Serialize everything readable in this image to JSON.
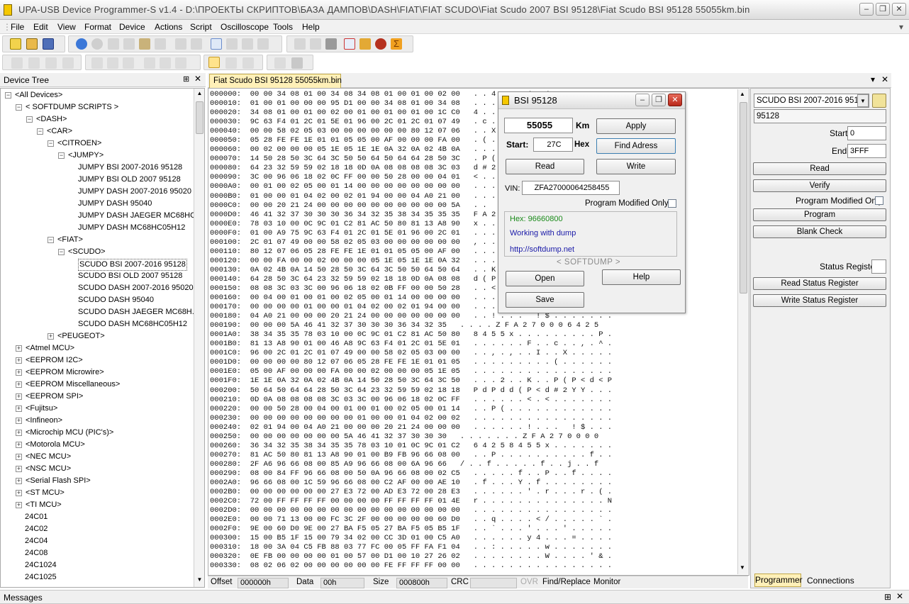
{
  "window": {
    "title": "UPA-USB Device Programmer-S v1.4 - D:\\ПРОЕКТЫ СКРИПТОВ\\БАЗА ДАМПОВ\\DASH\\FIAT\\FIAT SCUDO\\Fiat Scudo 2007 BSI 95128\\Fiat Scudo BSI 95128   55055km.bin"
  },
  "menu": [
    "File",
    "Edit",
    "View",
    "Format",
    "Device",
    "Actions",
    "Script",
    "Oscilloscope",
    "Tools",
    "Help"
  ],
  "device_tree": {
    "title": "Device Tree",
    "nodes": [
      {
        "label": "<All Devices>",
        "level": 0,
        "exp": "-"
      },
      {
        "label": "< SOFTDUMP SCRIPTS >",
        "level": 1,
        "exp": "-"
      },
      {
        "label": "<DASH>",
        "level": 2,
        "exp": "-"
      },
      {
        "label": "<CAR>",
        "level": 3,
        "exp": "-"
      },
      {
        "label": "<CITROEN>",
        "level": 4,
        "exp": "-"
      },
      {
        "label": "<JUMPY>",
        "level": 5,
        "exp": "-"
      },
      {
        "label": "JUMPY BSI 2007-2016 95128",
        "level": 6,
        "exp": ""
      },
      {
        "label": "JUMPY BSI OLD 2007 95128",
        "level": 6,
        "exp": ""
      },
      {
        "label": "JUMPY DASH 2007-2016 95020",
        "level": 6,
        "exp": ""
      },
      {
        "label": "JUMPY DASH 95040",
        "level": 6,
        "exp": ""
      },
      {
        "label": "JUMPY DASH JAEGER MC68HC...",
        "level": 6,
        "exp": ""
      },
      {
        "label": "JUMPY DASH MC68HC05H12",
        "level": 6,
        "exp": ""
      },
      {
        "label": "<FIAT>",
        "level": 4,
        "exp": "-"
      },
      {
        "label": "<SCUDO>",
        "level": 5,
        "exp": "-"
      },
      {
        "label": "SCUDO BSI 2007-2016 95128",
        "level": 6,
        "exp": "",
        "selected": true
      },
      {
        "label": "SCUDO BSI OLD 2007 95128",
        "level": 6,
        "exp": ""
      },
      {
        "label": "SCUDO DASH 2007-2016 95020",
        "level": 6,
        "exp": ""
      },
      {
        "label": "SCUDO DASH 95040",
        "level": 6,
        "exp": ""
      },
      {
        "label": "SCUDO DASH JAEGER MC68H...",
        "level": 6,
        "exp": ""
      },
      {
        "label": "SCUDO DASH MC68HC05H12",
        "level": 6,
        "exp": ""
      },
      {
        "label": "<PEUGEOT>",
        "level": 4,
        "exp": "+"
      },
      {
        "label": "<Atmel MCU>",
        "level": 1,
        "exp": "+"
      },
      {
        "label": "<EEPROM I2C>",
        "level": 1,
        "exp": "+"
      },
      {
        "label": "<EEPROM Microwire>",
        "level": 1,
        "exp": "+"
      },
      {
        "label": "<EEPROM Miscellaneous>",
        "level": 1,
        "exp": "+"
      },
      {
        "label": "<EEPROM SPI>",
        "level": 1,
        "exp": "+"
      },
      {
        "label": "<Fujitsu>",
        "level": 1,
        "exp": "+"
      },
      {
        "label": "<Infineon>",
        "level": 1,
        "exp": "+"
      },
      {
        "label": "<Microchip MCU (PIC's)>",
        "level": 1,
        "exp": "+"
      },
      {
        "label": "<Motorola MCU>",
        "level": 1,
        "exp": "+"
      },
      {
        "label": "<NEC MCU>",
        "level": 1,
        "exp": "+"
      },
      {
        "label": "<NSC MCU>",
        "level": 1,
        "exp": "+"
      },
      {
        "label": "<Serial Flash SPI>",
        "level": 1,
        "exp": "+"
      },
      {
        "label": "<ST MCU>",
        "level": 1,
        "exp": "+"
      },
      {
        "label": "<TI MCU>",
        "level": 1,
        "exp": "+"
      },
      {
        "label": "24C01",
        "level": 1,
        "exp": ""
      },
      {
        "label": "24C02",
        "level": 1,
        "exp": ""
      },
      {
        "label": "24C04",
        "level": 1,
        "exp": ""
      },
      {
        "label": "24C08",
        "level": 1,
        "exp": ""
      },
      {
        "label": "24C1024",
        "level": 1,
        "exp": ""
      },
      {
        "label": "24C1025",
        "level": 1,
        "exp": ""
      }
    ]
  },
  "editor_tab": "Fiat Scudo BSI 95128   55055km.bin",
  "hex_lines": [
    "000000:  00 00 34 08 01 00 34 08 34 08 01 00 01 00 02 00   . . 4 . . . 4 . 4 . . . . . . .",
    "000010:  01 00 01 00 00 00 95 D1 00 00 34 08 01 00 34 08   . . . . . . . . . . 4 . . . 4 .",
    "000020:  34 08 01 00 01 00 02 00 01 00 01 00 01 00 1C C0   4 . . . . . . . . . . . . . . .",
    "000030:  9C 63 F4 01 2C 01 5E 01 96 00 2C 01 2C 01 07 49   . c . . , . ^ . . . , . , . . I",
    "000040:  00 00 58 02 05 03 00 00 00 00 00 00 80 12 07 06   . . X . . . . . . . . . . . . .",
    "000050:  05 28 FE FE 1E 01 01 05 05 00 AF 00 00 00 FA 00   . ( . . . . . . . . . . . . . .",
    "000060:  00 02 00 00 00 05 1E 05 1E 1E 0A 32 0A 02 4B 0A   . . . . . . . . . . . 2 . . K .",
    "000070:  14 50 28 50 3C 64 3C 50 50 64 50 64 64 28 50 3C   . P ( P < d < P P d P d d ( P <",
    "000080:  64 23 32 59 59 02 18 18 0D 0A 08 08 08 08 3C 03   d # 2 Y Y . . . . . . . . . < .",
    "000090:  3C 00 96 06 18 02 0C FF 00 00 50 28 00 00 04 01   < . . . . . . . . . P ( . . . .",
    "0000A0:  00 01 00 02 05 00 01 14 00 00 00 00 00 00 00 00   . . . . . . . . . . . . . . . .",
    "0000B0:  01 00 00 01 04 02 00 02 01 94 00 00 04 A0 21 00   . . . . . . . . . . . . . . ! .",
    "0000C0:  00 00 20 21 24 00 00 00 00 00 00 00 00 00 00 5A   . .   ! $ . . . . . . . . . . Z",
    "0000D0:  46 41 32 37 30 30 30 36 34 32 35 38 34 35 35 35   F A 2 7 0 0 0 6 4 2 5 8 4 5 5 5",
    "0000E0:  78 03 10 00 0C 9C 01 C2 81 AC 50 80 81 13 A8 90   x . . . . . . . . . P . . . . .",
    "0000F0:  01 00 A9 75 9C 63 F4 01 2C 01 5E 01 96 00 2C 01   . . . u . c . . , . ^ . . . , .",
    "000100:  2C 01 07 49 00 00 58 02 05 03 00 00 00 00 00 00   , . . I . . X . . . . . . . . .",
    "000110:  80 12 07 06 05 28 FE FE 1E 01 01 05 05 00 AF 00   . . . . . ( . . . . . . . . . .",
    "000120:  00 00 FA 00 00 02 00 00 00 05 1E 05 1E 1E 0A 32   . . . . . . . . . . . . . . . 2",
    "000130:  0A 02 4B 0A 14 50 28 50 3C 64 3C 50 50 64 50 64   . . K . . P ( P < d < P P d P d",
    "000140:  64 28 50 3C 64 23 32 59 59 02 18 18 0D 0A 08 08   d ( P < d # 2 Y Y . . . . . . .",
    "000150:  08 08 3C 03 3C 00 96 06 18 02 0B FF 00 00 50 28   . . < . < . . . . . . . . . P (",
    "000160:  00 04 00 01 00 01 00 02 05 00 01 14 00 00 00 00   . . . . . . . . . . . . . . . .",
    "000170:  00 00 00 00 01 00 00 01 04 02 00 02 01 94 00 00   . . . . . . . . . . . . . . . .",
    "000180:  04 A0 21 00 00 00 20 21 24 00 00 00 00 00 00 00   . . ! . . .   ! $ . . . . . . .",
    "000190:  00 00 00 5A 46 41 32 37 30 30 30 36 34 32 35   . . . . Z F A 2 7 0 0 0 6 4 2 5",
    "0001A0:  38 34 35 35 78 03 10 00 0C 9C 01 C2 81 AC 50 80   8 4 5 5 x . . . . . . . . . P .",
    "0001B0:  81 13 A8 90 01 00 46 A8 9C 63 F4 01 2C 01 5E 01   . . . . . . F . . c . . , . ^ .",
    "0001C0:  96 00 2C 01 2C 01 07 49 00 00 58 02 05 03 00 00   . . , . , . . I . . X . . . . .",
    "0001D0:  00 00 00 00 80 12 07 06 05 28 FE FE 1E 01 01 05   . . . . . . . . . ( . . . . . .",
    "0001E0:  05 00 AF 00 00 00 FA 00 00 02 00 00 00 05 1E 05   . . . . . . . . . . . . . . . .",
    "0001F0:  1E 1E 0A 32 0A 02 4B 0A 14 50 28 50 3C 64 3C 50   . . . 2 . . K . . P ( P < d < P",
    "000200:  50 64 50 64 64 28 50 3C 64 23 32 59 59 02 18 18   P d P d d ( P < d # 2 Y Y . . .",
    "000210:  0D 0A 08 08 08 08 3C 03 3C 00 96 06 18 02 0C FF   . . . . . . < . < . . . . . . .",
    "000220:  00 00 50 28 00 04 00 01 00 01 00 02 05 00 01 14   . . P ( . . . . . . . . . . . .",
    "000230:  00 00 00 00 00 00 00 00 01 00 00 01 04 02 00 02   . . . . . . . . . . . . . . . .",
    "000240:  02 01 94 00 04 A0 21 00 00 00 20 21 24 00 00 00   . . . . . . ! . . .   ! $ . . .",
    "000250:  00 00 00 00 00 00 00 5A 46 41 32 37 30 30 30   . . . . . . . Z F A 2 7 0 0 0 0",
    "000260:  36 34 32 35 38 34 35 35 78 03 10 01 0C 9C 01 C2   6 4 2 5 8 4 5 5 x . . . . . . .",
    "000270:  81 AC 50 80 81 13 A8 90 01 00 B9 FB 96 66 08 00   . . P . . . . . . . . . . f . .",
    "000280:  2F A6 96 66 08 00 85 A9 96 66 08 00 6A 96 66   / . . f . . . . . f . . j . . f",
    "000290:  08 00 84 FF 96 66 08 00 50 0A 96 66 08 00 02 C5   . . . . . f . . P . . f . . . .",
    "0002A0:  96 66 08 00 1C 59 96 66 08 00 C2 AF 00 00 AE 10   . f . . . Y . f . . . . . . . .",
    "0002B0:  00 00 00 00 00 00 27 E3 72 00 AD E3 72 00 28 E3   . . . . . . ' . r . . . r . ( .",
    "0002C0:  72 00 FF FF FF FF 00 00 00 00 FF FF FF FF 01 4E   r . . . . . . . . . . . . . . N",
    "0002D0:  00 00 00 00 00 00 00 00 00 00 00 00 00 00 00 00   . . . . . . . . . . . . . . . .",
    "0002E0:  00 00 71 13 00 00 FC 3C 2F 00 00 00 00 00 60 D0   . . q . . . . < / . . . . . ` .",
    "0002F0:  9E 00 60 D0 9E 00 27 BA F5 05 27 BA F5 05 B5 1F   . . ` . . . ' . . . ' . . . . .",
    "000300:  15 00 B5 1F 15 00 79 34 02 00 CC 3D 01 00 C5 A0   . . . . . . y 4 . . . = . . . .",
    "000310:  18 00 3A 04 C5 FB 88 03 77 FC 00 05 FF FA F1 04   . . : . . . . . w . . . . . . .",
    "000320:  0E FB 00 00 00 00 01 00 57 00 D1 00 10 27 26 02   . . . . . . . . W . . . . ' & .",
    "000330:  08 02 06 02 00 00 00 00 00 00 FE FF FF FF 00 00   . . . . . . . . . . . . . . . ."
  ],
  "dialog": {
    "title": "BSI 95128",
    "km_value": "55055",
    "km_unit": "Km",
    "start_label": "Start:",
    "start_value": "27C",
    "hex_unit": "Hex",
    "vin_label": "VIN:",
    "vin_value": "ZFA27000064258455",
    "program_modified_only": "Program Modified Only",
    "info_hex": "Hex: 96660800",
    "info_working": "Working with dump",
    "info_url": "http://softdump.net",
    "brand": "< SOFTDUMP >",
    "buttons": {
      "apply": "Apply",
      "find": "Find Adress",
      "read": "Read",
      "write": "Write",
      "open": "Open",
      "help": "Help",
      "save": "Save"
    }
  },
  "programmer": {
    "device": "SCUDO BSI 2007-2016 95128",
    "chip": "95128",
    "start_label": "Start",
    "start_value": "0",
    "end_label": "End",
    "end_value": "3FFF",
    "read": "Read",
    "verify": "Verify",
    "program_modified_only": "Program Modified Only",
    "program": "Program",
    "blank_check": "Blank Check",
    "status_register": "Status Register",
    "read_status_register": "Read Status Register",
    "write_status_register": "Write Status Register",
    "tabs": [
      "Programmer",
      "Connections"
    ]
  },
  "statusbar": {
    "offset_label": "Offset",
    "offset_value": "000000h",
    "data_label": "Data",
    "data_value": "00h",
    "size_label": "Size",
    "size_value": "000800h",
    "crc_label": "CRC",
    "crc_value": "",
    "ovr": "OVR",
    "find_replace": "Find/Replace",
    "monitor": "Monitor"
  },
  "messages": {
    "title": "Messages"
  },
  "colors": {
    "info_green": "#1a8a1a",
    "info_blue": "#1a1aa8",
    "tab_active": "#fff0b8"
  }
}
